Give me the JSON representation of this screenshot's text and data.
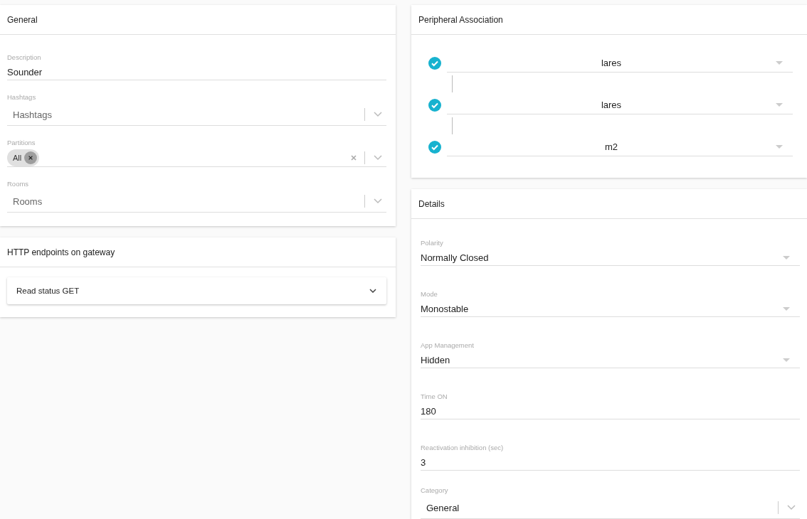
{
  "general": {
    "title": "General",
    "fields": [
      {
        "kind": "text",
        "label": "Description",
        "value": "Sounder"
      },
      {
        "kind": "multi",
        "label": "Hashtags",
        "placeholder": "Hashtags"
      },
      {
        "kind": "multi",
        "label": "Partitions",
        "chips": [
          "All"
        ],
        "clearable": true
      },
      {
        "kind": "multi",
        "label": "Rooms",
        "placeholder": "Rooms"
      }
    ]
  },
  "http": {
    "title": "HTTP endpoints on gateway",
    "endpoints": [
      {
        "label": "Read status GET",
        "expanded": false
      }
    ]
  },
  "peripheral": {
    "title": "Peripheral Association",
    "items": [
      {
        "value": "lares",
        "checked": true
      },
      {
        "value": "lares",
        "checked": true
      },
      {
        "value": "m2",
        "checked": true
      }
    ]
  },
  "details": {
    "title": "Details",
    "fields": [
      {
        "kind": "dropdown",
        "label": "Polarity",
        "value": "Normally Closed"
      },
      {
        "kind": "dropdown",
        "label": "Mode",
        "value": "Monostable"
      },
      {
        "kind": "dropdown",
        "label": "App Management",
        "value": "Hidden"
      },
      {
        "kind": "text",
        "label": "Time ON",
        "value": "180"
      },
      {
        "kind": "text",
        "label": "Reactivation inhibition (sec)",
        "value": "3"
      },
      {
        "kind": "multi",
        "label": "Category",
        "value": "General"
      }
    ]
  }
}
